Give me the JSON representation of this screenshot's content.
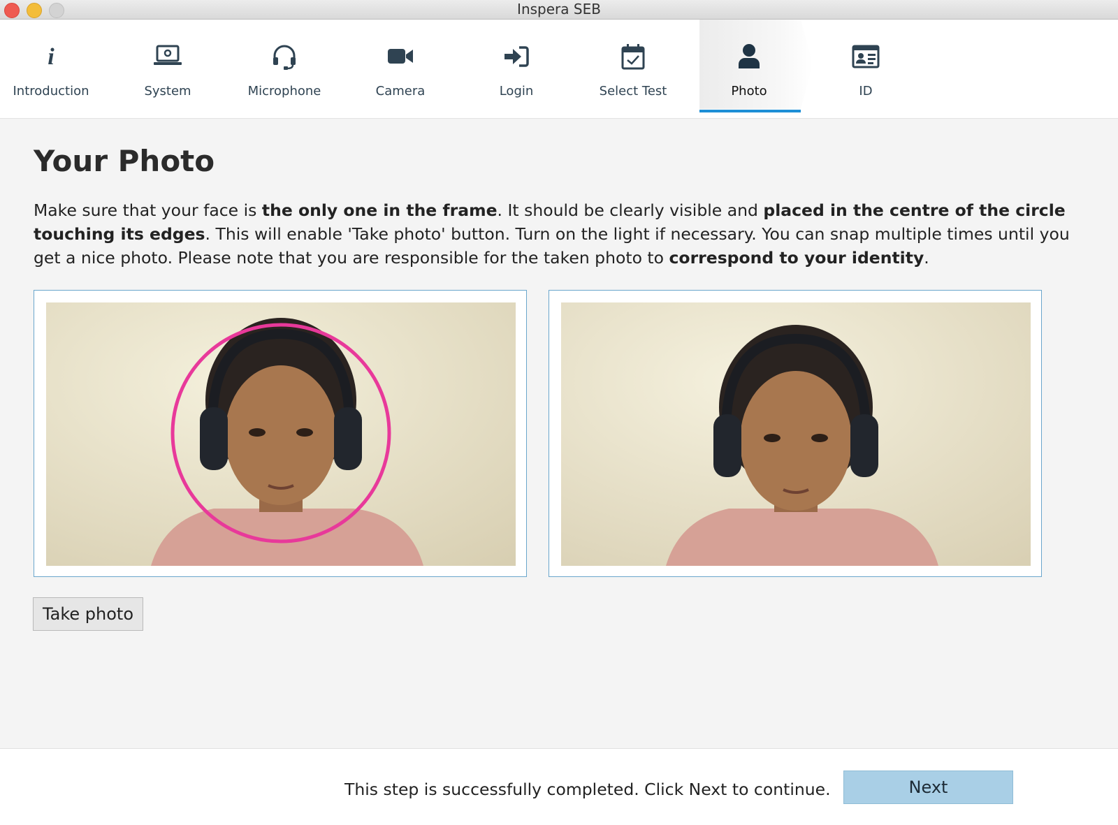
{
  "window": {
    "title": "Inspera SEB"
  },
  "steps": [
    {
      "label": "Introduction",
      "icon": "info-icon"
    },
    {
      "label": "System",
      "icon": "laptop-icon"
    },
    {
      "label": "Microphone",
      "icon": "headset-icon"
    },
    {
      "label": "Camera",
      "icon": "video-camera-icon"
    },
    {
      "label": "Login",
      "icon": "sign-in-icon"
    },
    {
      "label": "Select Test",
      "icon": "calendar-check-icon"
    },
    {
      "label": "Photo",
      "icon": "user-icon",
      "active": true
    },
    {
      "label": "ID",
      "icon": "id-card-icon"
    }
  ],
  "main": {
    "title": "Your Photo",
    "intro": {
      "p1": "Make sure that your face is ",
      "b1": "the only one in the frame",
      "p2": ". It should be clearly visible and ",
      "b2": "placed in the centre of the circle touching its edges",
      "p3": ". This will enable 'Take photo' button. Turn on the light if necessary. You can snap multiple times until you get a nice photo. Please note that you are responsible for the taken photo to ",
      "b3": "correspond to your identity",
      "p4": "."
    },
    "take_photo_label": "Take photo"
  },
  "footer": {
    "status": "This step is successfully completed. Click Next to continue.",
    "next_label": "Next"
  },
  "colors": {
    "accent": "#1e8fd6",
    "guide_circle": "#e8399a",
    "next_button": "#a9cfe6",
    "nav_icon": "#2f4352"
  }
}
